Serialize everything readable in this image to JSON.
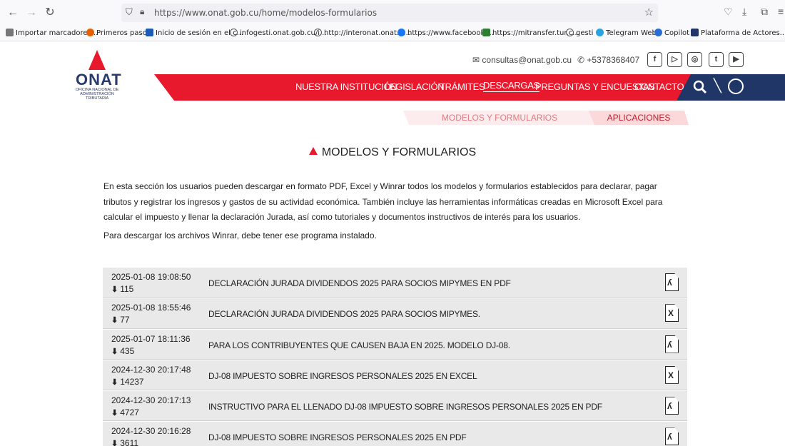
{
  "browser": {
    "url": "https://www.onat.gob.cu/home/modelos-formularios",
    "bookmarks": [
      "Importar marcadores...",
      "Primeros pasos",
      "Inicio de sesión en el c...",
      "infogesti.onat.gob.cu/i...",
      "http://interonat.onat.g...",
      "https://www.facebook....",
      "https://mitransfer.tur.c...",
      "gesti",
      "Telegram Web",
      "Copilot",
      "Plataforma de Actores..."
    ]
  },
  "header": {
    "logo_text": "ONAT",
    "logo_sub": "OFICINA NACIONAL DE ADMINISTRACIÓN TRIBUTARIA",
    "email": "consultas@onat.gob.cu",
    "phone": "+5378368407",
    "social": [
      "f",
      "▷",
      "◎",
      "t",
      "▶"
    ]
  },
  "menu": {
    "items": [
      "NUESTRA INSTITUCIÓN",
      "LEGISLACIÓN",
      "TRÁMITES",
      "DESCARGAS",
      "PREGUNTAS Y ENCUESTAS",
      "CONTACTO"
    ],
    "active": "DESCARGAS"
  },
  "subtabs": [
    "MODELOS Y FORMULARIOS",
    "APLICACIONES"
  ],
  "page": {
    "title": "MODELOS Y FORMULARIOS",
    "intro": "En esta sección los usuarios pueden descargar en formato PDF, Excel y Winrar  todos los modelos y formularios establecidos para declarar, pagar tributos y registrar los ingresos y gastos de su actividad económica. También incluye las herramientas informáticas creadas en Microsoft Excel para calcular el impuesto y llenar la declaración Jurada, así como tutoriales y documentos instructivos de interés para los usuarios.",
    "note": "Para descargar los archivos Winrar, debe tener ese programa instalado."
  },
  "files": [
    {
      "date": "2025-01-08 19:08:50",
      "downloads": "115",
      "title": "DECLARACIÓN JURADA DIVIDENDOS 2025 PARA SOCIOS MIPYMES EN PDF",
      "type": "pdf"
    },
    {
      "date": "2025-01-08 18:55:46",
      "downloads": "77",
      "title": "DECLARACIÓN JURADA DIVIDENDOS 2025 PARA SOCIOS MIPYMES.",
      "type": "excel"
    },
    {
      "date": "2025-01-07 18:11:36",
      "downloads": "435",
      "title": "PARA LOS CONTRIBUYENTES QUE CAUSEN BAJA EN 2025. MODELO DJ-08.",
      "type": "pdf"
    },
    {
      "date": "2024-12-30 20:17:48",
      "downloads": "14237",
      "title": "DJ-08 IMPUESTO SOBRE INGRESOS PERSONALES 2025 EN EXCEL",
      "type": "excel"
    },
    {
      "date": "2024-12-30 20:17:13",
      "downloads": "4727",
      "title": "INSTRUCTIVO PARA EL LLENADO DJ-08 IMPUESTO SOBRE INGRESOS PERSONALES 2025 EN PDF",
      "type": "pdf"
    },
    {
      "date": "2024-12-30 20:16:28",
      "downloads": "3611",
      "title": "DJ-08 IMPUESTO SOBRE INGRESOS PERSONALES 2025 EN PDF",
      "type": "pdf"
    }
  ]
}
